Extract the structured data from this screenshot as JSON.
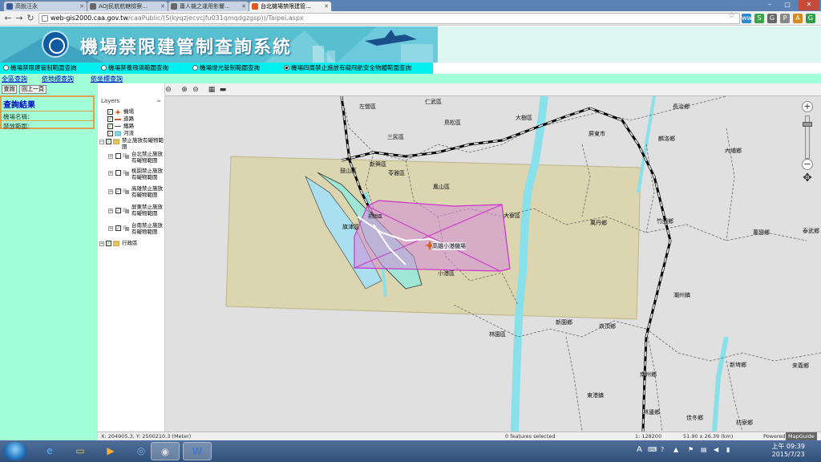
{
  "browser": {
    "tabs": [
      {
        "label": "高銳汪永",
        "icon_color": "#3b5998"
      },
      {
        "label": "AOJ民航航轄檢察...",
        "icon_color": "#666666"
      },
      {
        "label": "蕭人機之運用影響...",
        "icon_color": "#666666"
      },
      {
        "label": "台北機場禁限建管...",
        "icon_color": "#e05a1b"
      }
    ],
    "url_host": "web-gis2000.caa.gov.tw",
    "url_path": "/caaPublic/(S(kyqzjecvcjfu031qmqdgzgsp))/Taipei.aspx",
    "extensions": [
      "ww",
      "S",
      "G",
      "P",
      "A",
      "G"
    ]
  },
  "banner": {
    "title": "機場禁限建管制查詢系統"
  },
  "query_options": [
    {
      "label": "機場禁限建管制範圍查詢",
      "selected": false
    },
    {
      "label": "機場禁養飛鴿範圍查詢",
      "selected": false
    },
    {
      "label": "機場燈光管制範圍查詢",
      "selected": false
    },
    {
      "label": "機場四周禁止施放有礙飛航安全物體範圍查詢",
      "selected": true
    }
  ],
  "links": [
    "全區查詢",
    "依地標查詢",
    "依坐標查詢"
  ],
  "left_panel": {
    "buttons": [
      "查詢",
      "回上一頁"
    ],
    "result_title": "查詢結果",
    "airport_label": "機場名稱：",
    "range_label": "禁放範圍："
  },
  "layers": {
    "header": "Layers",
    "items": [
      {
        "label": "機場",
        "checked": true
      },
      {
        "label": "道路",
        "checked": true
      },
      {
        "label": "鐵路",
        "checked": true
      },
      {
        "label": "河流",
        "checked": true
      },
      {
        "label": "禁止施放有礙物範圍",
        "checked": true
      },
      {
        "label": "台北禁止施放有礙物範圍",
        "checked": false
      },
      {
        "label": "桃園禁止施放有礙物範圍",
        "checked": false
      },
      {
        "label": "高雄禁止施放有礙物範圍",
        "checked": true
      },
      {
        "label": "屏東禁止施放有礙物範圍",
        "checked": true
      },
      {
        "label": "台南禁止施放有礙物範圍",
        "checked": true
      },
      {
        "label": "行政區",
        "checked": true
      }
    ]
  },
  "map": {
    "airport_label": "高雄小港機場",
    "districts": [
      "仁武區",
      "左營區",
      "大樹區",
      "長治鄉",
      "鳥松區",
      "三民區",
      "屏東市",
      "麟洛鄉",
      "內埔鄉",
      "新興區",
      "苓雅區",
      "鼓山區",
      "鳳山區",
      "前鎮區",
      "旗津區",
      "大寮區",
      "萬丹鄉",
      "竹田鄉",
      "萬巒鄉",
      "泰武鄉",
      "小港區",
      "潮州鎮",
      "林園區",
      "新園鄉",
      "崁頂鄉",
      "新埤鄉",
      "來義鄉",
      "南州鄉",
      "東港鎮",
      "林邊鄉",
      "佳冬鄉",
      "枋寮鄉"
    ]
  },
  "status": {
    "coords": "X: 204905.3, Y: 2500210.3 (Meter)",
    "features": "0 features selected",
    "scale": "1: 128200",
    "size": "51.90 x 26.39 (km)",
    "powered": "Powered by",
    "brand": "MapGuide"
  },
  "taskbar": {
    "lang": "A",
    "time": "上午 09:39",
    "date": "2015/7/23"
  }
}
